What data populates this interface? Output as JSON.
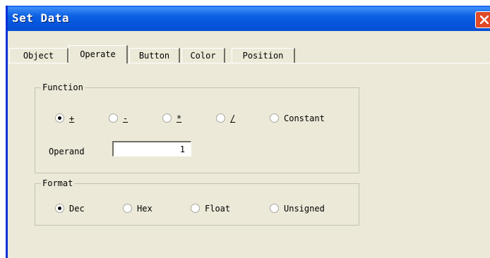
{
  "window": {
    "title": "Set Data"
  },
  "tabs": [
    {
      "label": "Object",
      "selected": false
    },
    {
      "label": "Operate",
      "selected": true
    },
    {
      "label": "Button",
      "selected": false
    },
    {
      "label": "Color",
      "selected": false
    },
    {
      "label": "Position",
      "selected": false
    }
  ],
  "function_group": {
    "legend": "Function",
    "options": [
      {
        "label": "+",
        "selected": true
      },
      {
        "label": "-",
        "selected": false
      },
      {
        "label": "*",
        "selected": false
      },
      {
        "label": "/",
        "selected": false
      },
      {
        "label": "Constant",
        "selected": false
      }
    ],
    "operand_label": "Operand",
    "operand_value": "1"
  },
  "format_group": {
    "legend": "Format",
    "options": [
      {
        "label": "Dec",
        "selected": true
      },
      {
        "label": "Hex",
        "selected": false
      },
      {
        "label": "Float",
        "selected": false
      },
      {
        "label": "Unsigned",
        "selected": false
      }
    ]
  },
  "icons": {
    "close": "close-icon"
  },
  "colors": {
    "titlebar": "#0655dc",
    "dialog": "#ece9d8",
    "close": "#e04a26"
  }
}
